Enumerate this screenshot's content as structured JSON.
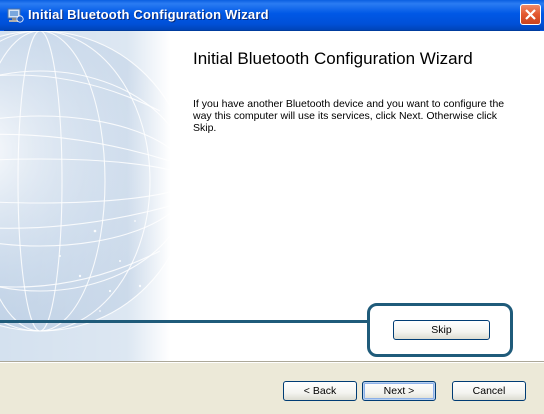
{
  "window": {
    "title": "Initial Bluetooth Configuration Wizard",
    "title_icon": "bluetooth-wizard-icon",
    "close_icon": "close-icon"
  },
  "content": {
    "heading": "Initial Bluetooth Configuration Wizard",
    "description": "If you have another Bluetooth device and you want to configure the way this computer will use its services, click Next. Otherwise click Skip."
  },
  "buttons": {
    "skip": "Skip",
    "back": "< Back",
    "next": "Next >",
    "cancel": "Cancel"
  },
  "colors": {
    "titlebar": "#0058e6",
    "close_button": "#e3582f",
    "footer": "#ece9d8",
    "highlight": "#1f5b7a"
  }
}
